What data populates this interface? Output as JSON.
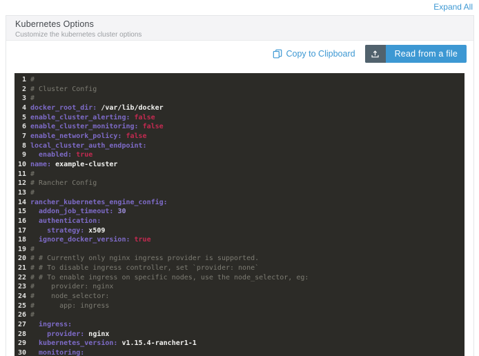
{
  "page": {
    "expand_all_label": "Expand All"
  },
  "section": {
    "title": "Kubernetes Options",
    "subtitle": "Customize the kubernetes cluster options"
  },
  "toolbar": {
    "copy_label": "Copy to Clipboard",
    "read_label": "Read from a file",
    "copy_icon": "copy-icon",
    "read_icon": "upload-icon"
  },
  "colors": {
    "accent_blue": "#3d98d3",
    "button_addon": "#51626d",
    "editor_bg": "#2c2b27",
    "key_purple": "#7e6bc8",
    "bool_red": "#c22a50",
    "number_purple": "#9c8cd9",
    "comment_gray": "#7d7c73",
    "header_bg": "#f4f4f6"
  },
  "editor": {
    "language": "yaml",
    "lines": [
      {
        "n": 1,
        "tokens": [
          {
            "c": "comment",
            "t": "#"
          }
        ]
      },
      {
        "n": 2,
        "tokens": [
          {
            "c": "comment",
            "t": "# Cluster Config"
          }
        ]
      },
      {
        "n": 3,
        "tokens": [
          {
            "c": "comment",
            "t": "#"
          }
        ]
      },
      {
        "n": 4,
        "tokens": [
          {
            "c": "key",
            "t": "docker_root_dir:"
          },
          {
            "c": "plain",
            "t": " /var/lib/docker"
          }
        ]
      },
      {
        "n": 5,
        "tokens": [
          {
            "c": "key",
            "t": "enable_cluster_alerting:"
          },
          {
            "c": "bool",
            "t": " false"
          }
        ]
      },
      {
        "n": 6,
        "tokens": [
          {
            "c": "key",
            "t": "enable_cluster_monitoring:"
          },
          {
            "c": "bool",
            "t": " false"
          }
        ]
      },
      {
        "n": 7,
        "tokens": [
          {
            "c": "key",
            "t": "enable_network_policy:"
          },
          {
            "c": "bool",
            "t": " false"
          }
        ]
      },
      {
        "n": 8,
        "tokens": [
          {
            "c": "key",
            "t": "local_cluster_auth_endpoint:"
          }
        ]
      },
      {
        "n": 9,
        "tokens": [
          {
            "c": "key",
            "t": "  enabled:"
          },
          {
            "c": "bool",
            "t": " true"
          }
        ]
      },
      {
        "n": 10,
        "tokens": [
          {
            "c": "key",
            "t": "name:"
          },
          {
            "c": "plain",
            "t": " example-cluster"
          }
        ]
      },
      {
        "n": 11,
        "tokens": [
          {
            "c": "comment",
            "t": "#"
          }
        ]
      },
      {
        "n": 12,
        "tokens": [
          {
            "c": "comment",
            "t": "# Rancher Config"
          }
        ]
      },
      {
        "n": 13,
        "tokens": [
          {
            "c": "comment",
            "t": "#"
          }
        ]
      },
      {
        "n": 14,
        "tokens": [
          {
            "c": "key",
            "t": "rancher_kubernetes_engine_config:"
          }
        ]
      },
      {
        "n": 15,
        "tokens": [
          {
            "c": "key",
            "t": "  addon_job_timeout:"
          },
          {
            "c": "num",
            "t": " 30"
          }
        ]
      },
      {
        "n": 16,
        "tokens": [
          {
            "c": "key",
            "t": "  authentication:"
          }
        ]
      },
      {
        "n": 17,
        "tokens": [
          {
            "c": "key",
            "t": "    strategy:"
          },
          {
            "c": "plain",
            "t": " x509"
          }
        ]
      },
      {
        "n": 18,
        "tokens": [
          {
            "c": "key",
            "t": "  ignore_docker_version:"
          },
          {
            "c": "bool",
            "t": " true"
          }
        ]
      },
      {
        "n": 19,
        "tokens": [
          {
            "c": "comment",
            "t": "#"
          }
        ]
      },
      {
        "n": 20,
        "tokens": [
          {
            "c": "comment",
            "t": "# # Currently only nginx ingress provider is supported."
          }
        ]
      },
      {
        "n": 21,
        "tokens": [
          {
            "c": "comment",
            "t": "# # To disable ingress controller, set `provider: none`"
          }
        ]
      },
      {
        "n": 22,
        "tokens": [
          {
            "c": "comment",
            "t": "# # To enable ingress on specific nodes, use the node_selector, eg:"
          }
        ]
      },
      {
        "n": 23,
        "tokens": [
          {
            "c": "comment",
            "t": "#    provider: nginx"
          }
        ]
      },
      {
        "n": 24,
        "tokens": [
          {
            "c": "comment",
            "t": "#    node_selector:"
          }
        ]
      },
      {
        "n": 25,
        "tokens": [
          {
            "c": "comment",
            "t": "#      app: ingress"
          }
        ]
      },
      {
        "n": 26,
        "tokens": [
          {
            "c": "comment",
            "t": "#"
          }
        ]
      },
      {
        "n": 27,
        "tokens": [
          {
            "c": "key",
            "t": "  ingress:"
          }
        ]
      },
      {
        "n": 28,
        "tokens": [
          {
            "c": "key",
            "t": "    provider:"
          },
          {
            "c": "plain",
            "t": " nginx"
          }
        ]
      },
      {
        "n": 29,
        "tokens": [
          {
            "c": "key",
            "t": "  kubernetes_version:"
          },
          {
            "c": "plain",
            "t": " v1.15.4-rancher1-1"
          }
        ]
      },
      {
        "n": 30,
        "tokens": [
          {
            "c": "key",
            "t": "  monitoring:"
          }
        ]
      }
    ]
  }
}
